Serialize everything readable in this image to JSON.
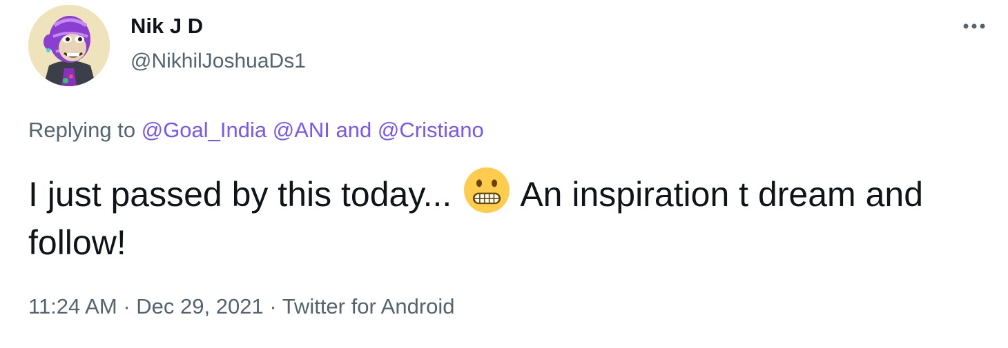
{
  "user": {
    "display_name": "Nik J D",
    "handle": "@NikhilJoshuaDs1"
  },
  "reply": {
    "prefix": "Replying to",
    "mentions": [
      "@Goal_India",
      "@ANI",
      "@Cristiano"
    ],
    "connector": "and"
  },
  "tweet": {
    "text_before_emoji": "I just passed by this today...",
    "emoji_name": "grimacing-face-emoji",
    "text_after_emoji": "An inspiration t dream and follow!"
  },
  "meta": {
    "time": "11:24 AM",
    "separator": "·",
    "date": "Dec 29, 2021",
    "source": "Twitter for Android"
  },
  "colors": {
    "mention": "#7856ff",
    "secondary_text": "#536471",
    "primary_text": "#0f1419",
    "emoji_face": "#ffcc4d"
  },
  "icons": {
    "more": "more-horizontal-icon",
    "avatar": "ape-avatar-image"
  }
}
